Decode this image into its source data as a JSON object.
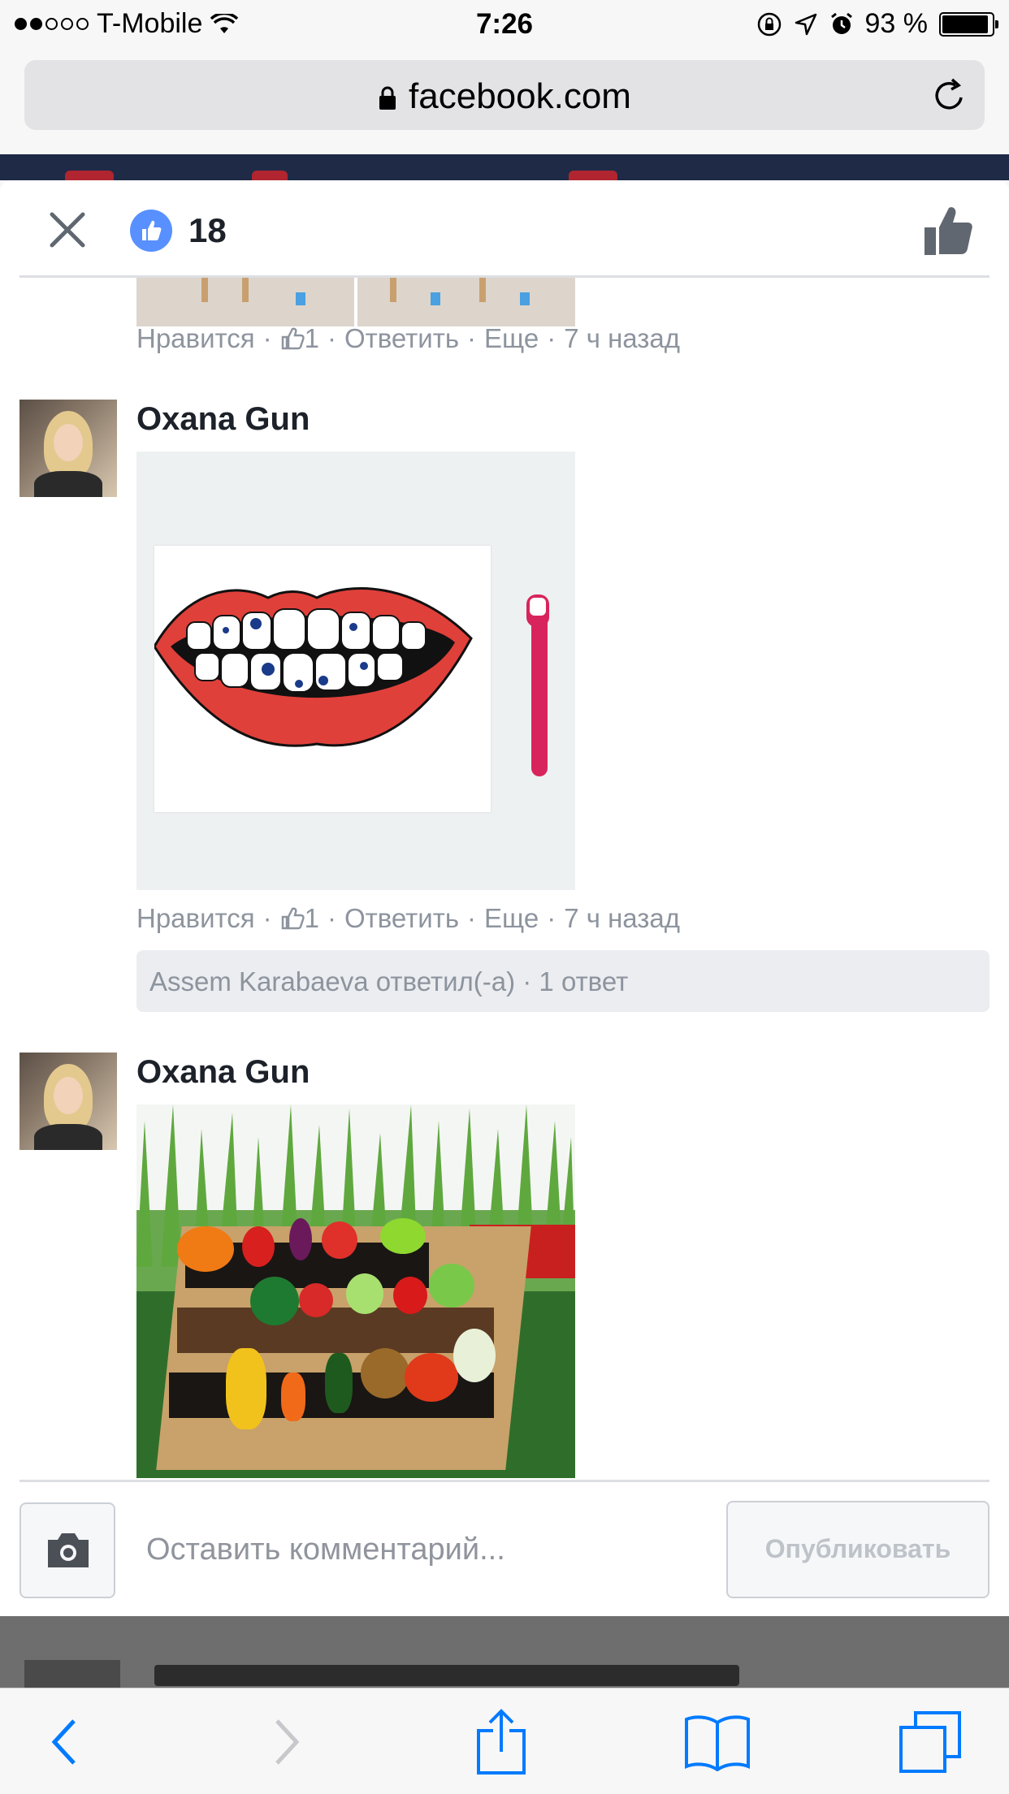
{
  "status_bar": {
    "carrier": "T-Mobile",
    "signal_icon": "signal-dots-icon",
    "wifi_icon": "wifi-icon",
    "time": "7:26",
    "battery_percent": "93 %",
    "battery_level": 0.93
  },
  "address_bar": {
    "url": "facebook.com",
    "lock_icon": "lock-icon",
    "reload_icon": "reload-icon"
  },
  "modal": {
    "close_icon": "close-icon",
    "like_count": "18",
    "like_badge_color": "#5890ff"
  },
  "comments": [
    {
      "meta": {
        "like": "Нравится",
        "likes": "1",
        "reply": "Ответить",
        "more": "Еще",
        "time": "7 ч назад"
      }
    },
    {
      "author": "Oxana Gun",
      "meta": {
        "like": "Нравится",
        "likes": "1",
        "reply": "Ответить",
        "more": "Еще",
        "time": "7 ч назад"
      },
      "replies_summary": "Assem Karabaeva ответил(-а) · 1 ответ"
    },
    {
      "author": "Oxana Gun"
    }
  ],
  "composer": {
    "camera_icon": "camera-icon",
    "placeholder": "Оставить комментарий...",
    "publish_label": "Опубликовать"
  },
  "toolbar": {
    "back_icon": "back-icon",
    "forward_icon": "forward-icon",
    "share_icon": "share-icon",
    "bookmarks_icon": "bookmarks-icon",
    "tabs_icon": "tabs-icon"
  },
  "colors": {
    "link_blue": "#007aff",
    "meta_gray": "#8d949e",
    "fb_dark": "#1e2a46"
  }
}
